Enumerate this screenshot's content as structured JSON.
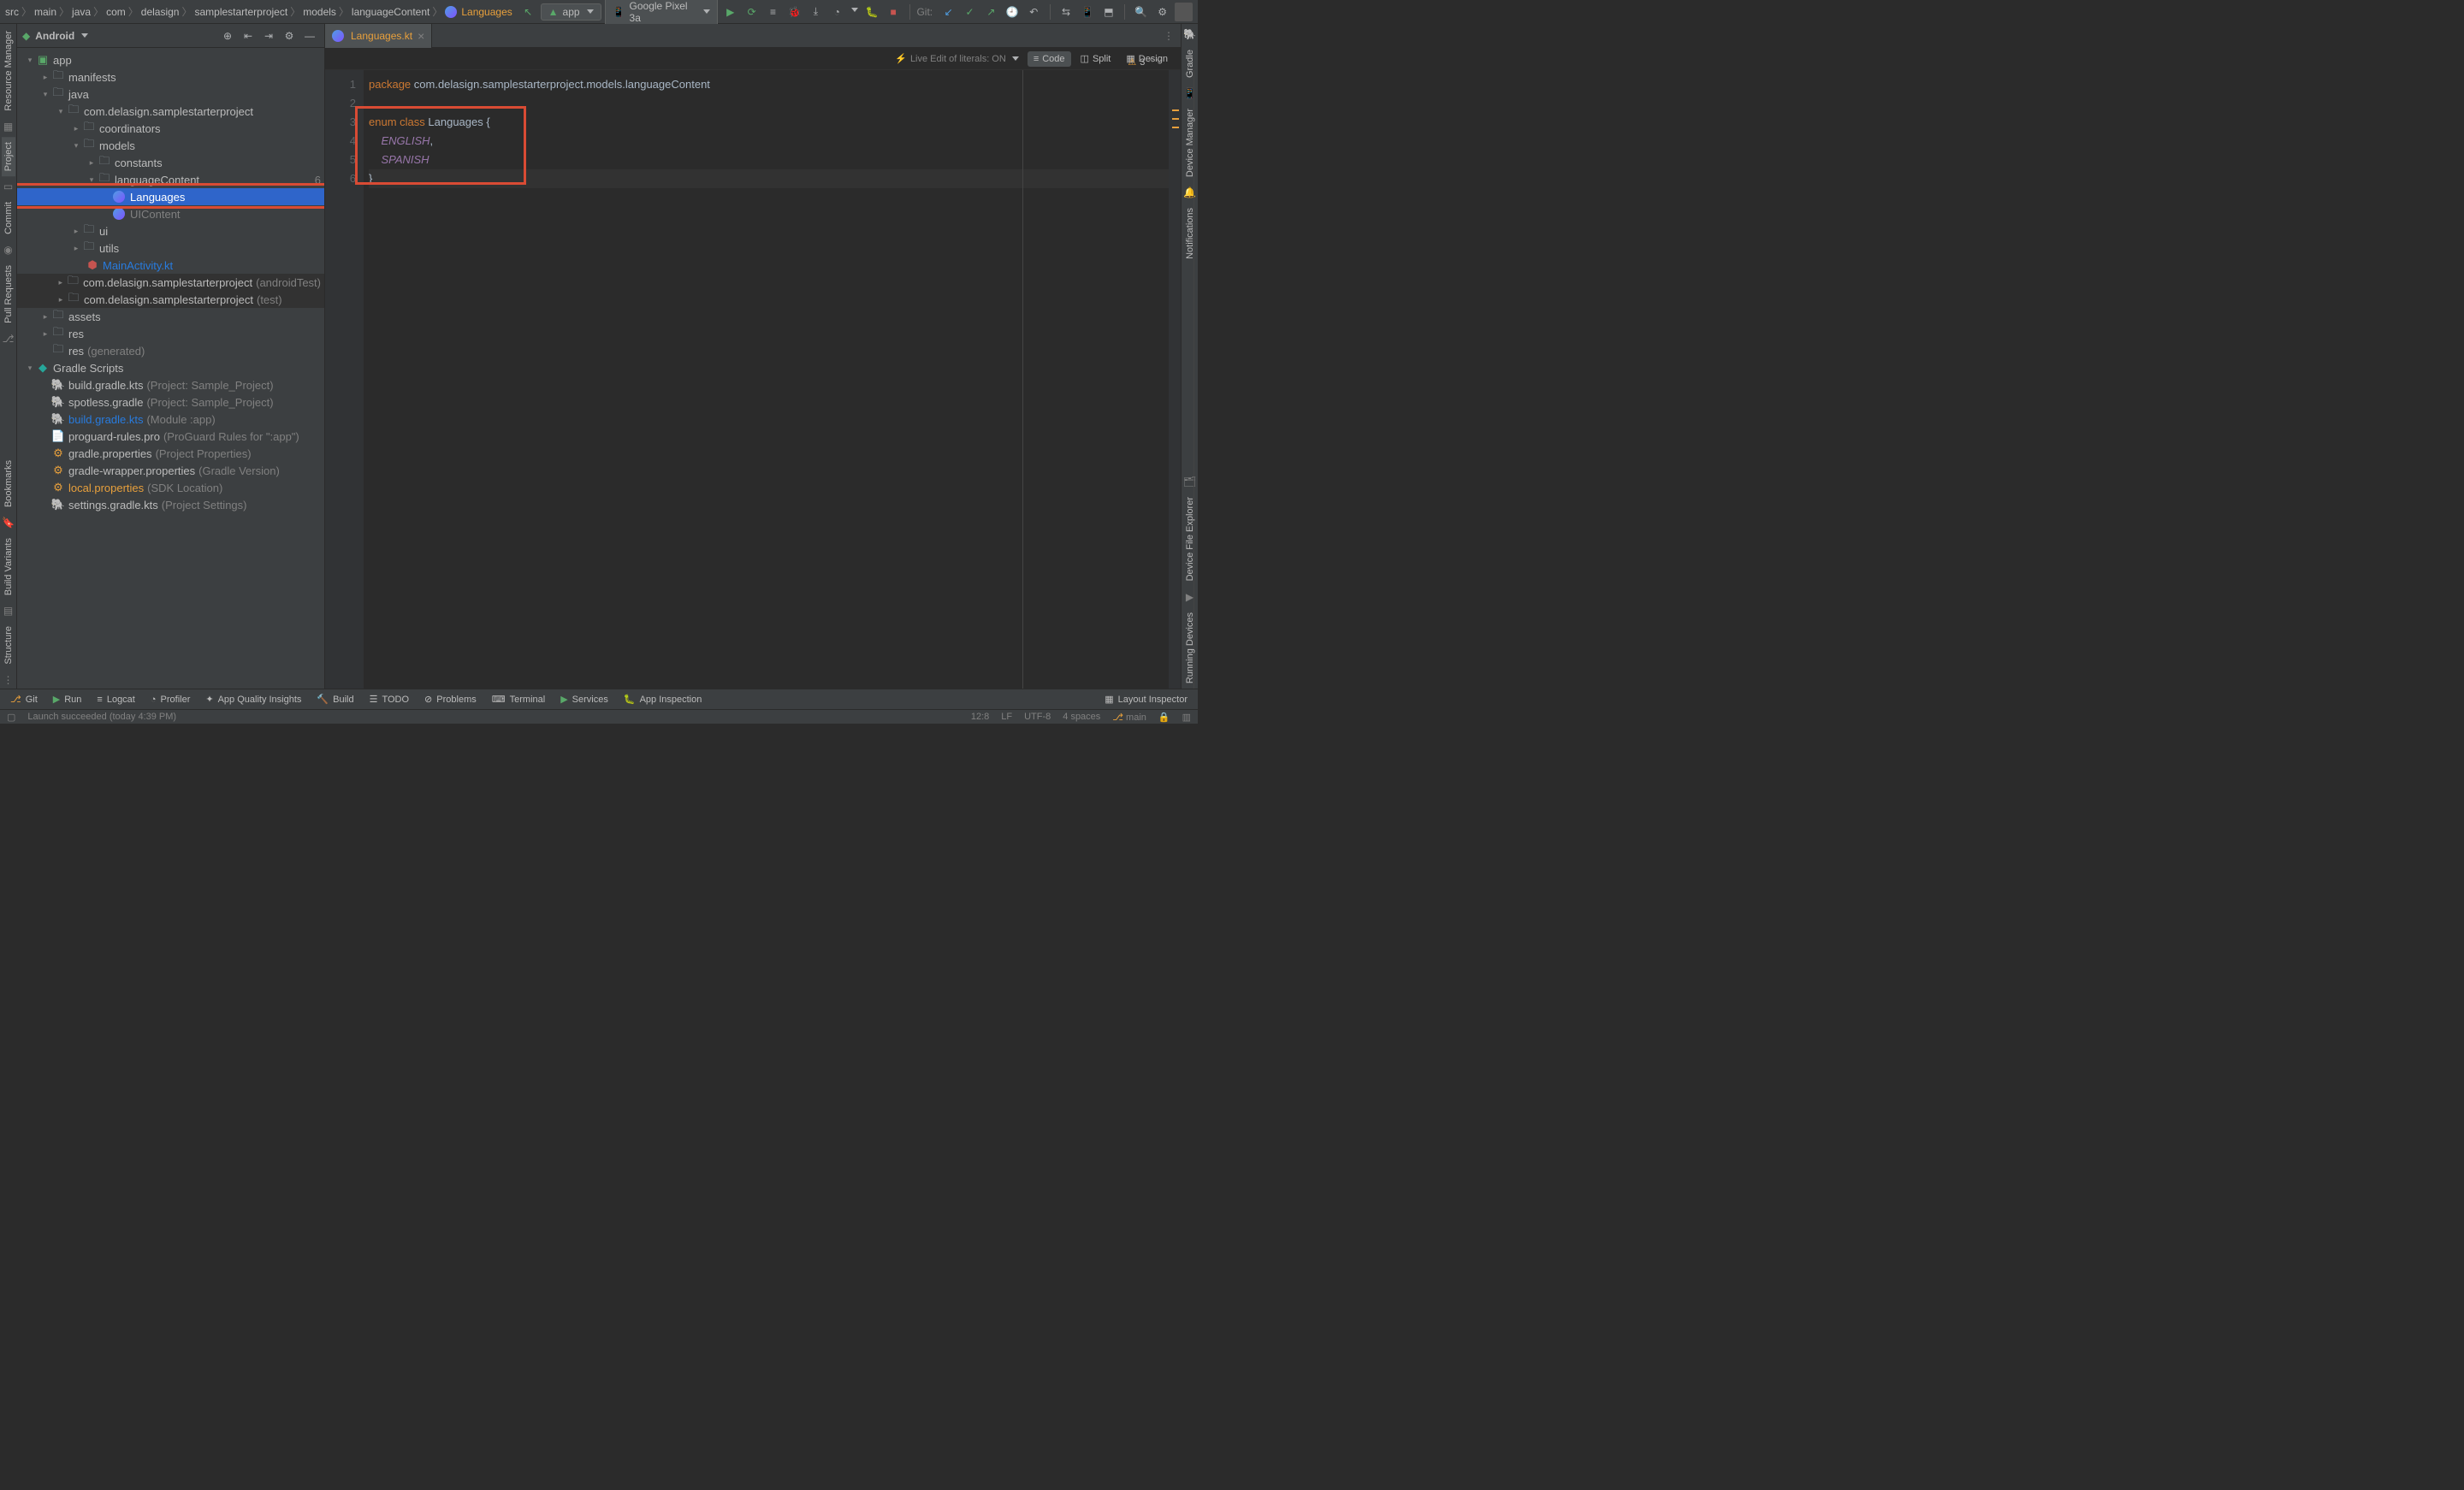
{
  "breadcrumbs": [
    "src",
    "main",
    "java",
    "com",
    "delasign",
    "samplestarterproject",
    "models",
    "languageContent",
    "Languages"
  ],
  "toolbar": {
    "run_config": "app",
    "device": "Google Pixel 3a",
    "git_label": "Git:"
  },
  "project_panel": {
    "title": "Android",
    "tree": {
      "app": "app",
      "manifests": "manifests",
      "java": "java",
      "pkg_main": "com.delasign.samplestarterproject",
      "coordinators": "coordinators",
      "models": "models",
      "constants": "constants",
      "languageContent": "languageContent",
      "languages": "Languages",
      "uicontent": "UIContent",
      "ui": "ui",
      "utils": "utils",
      "mainactivity": "MainActivity.kt",
      "pkg_android_test": "com.delasign.samplestarterproject",
      "pkg_android_test_suffix": "(androidTest)",
      "pkg_test": "com.delasign.samplestarterproject",
      "pkg_test_suffix": "(test)",
      "assets": "assets",
      "res": "res",
      "res_gen": "res",
      "res_gen_suffix": "(generated)",
      "gradle_scripts": "Gradle Scripts",
      "build_gradle_proj": "build.gradle.kts",
      "build_gradle_proj_suffix": "(Project: Sample_Project)",
      "spotless": "spotless.gradle",
      "spotless_suffix": "(Project: Sample_Project)",
      "build_gradle_app": "build.gradle.kts",
      "build_gradle_app_suffix": "(Module :app)",
      "proguard": "proguard-rules.pro",
      "proguard_suffix": "(ProGuard Rules for \":app\")",
      "gradle_props": "gradle.properties",
      "gradle_props_suffix": "(Project Properties)",
      "wrapper_props": "gradle-wrapper.properties",
      "wrapper_props_suffix": "(Gradle Version)",
      "local_props": "local.properties",
      "local_props_suffix": "(SDK Location)",
      "settings": "settings.gradle.kts",
      "settings_suffix": "(Project Settings)"
    }
  },
  "left_rail": {
    "resource_manager": "Resource Manager",
    "project": "Project",
    "commit": "Commit",
    "pull_requests": "Pull Requests",
    "bookmarks": "Bookmarks",
    "build_variants": "Build Variants",
    "structure": "Structure"
  },
  "right_rail": {
    "gradle": "Gradle",
    "device_manager": "Device Manager",
    "notifications": "Notifications",
    "device_file_explorer": "Device File Explorer",
    "running_devices": "Running Devices"
  },
  "tab": {
    "name": "Languages.kt"
  },
  "editor_toolbar": {
    "live_edit": "Live Edit of literals: ON",
    "code": "Code",
    "split": "Split",
    "design": "Design"
  },
  "problems": {
    "warn_count": "3"
  },
  "code": {
    "l1_kw": "package",
    "l1_pkg": " com.delasign.samplestarterproject.models.languageContent",
    "l3": "enum class Languages {",
    "l3_kw1": "enum",
    "l3_kw2": "class",
    "l3_cls": "Languages",
    "l3_brace": "{",
    "l4": "    ENGLISH,",
    "l4_val": "ENGLISH",
    "l4_comma": ",",
    "l5": "    SPANISH",
    "l5_val": "SPANISH",
    "l6": "}"
  },
  "gutter": [
    "1",
    "2",
    "3",
    "4",
    "5",
    "6"
  ],
  "bottom": {
    "git": "Git",
    "run": "Run",
    "logcat": "Logcat",
    "profiler": "Profiler",
    "app_quality": "App Quality Insights",
    "build": "Build",
    "todo": "TODO",
    "problems": "Problems",
    "terminal": "Terminal",
    "services": "Services",
    "app_inspection": "App Inspection",
    "layout_inspector": "Layout Inspector"
  },
  "status": {
    "message": "Launch succeeded (today 4:39 PM)",
    "pos": "12:8",
    "le": "LF",
    "enc": "UTF-8",
    "indent": "4 spaces",
    "branch": "main"
  }
}
